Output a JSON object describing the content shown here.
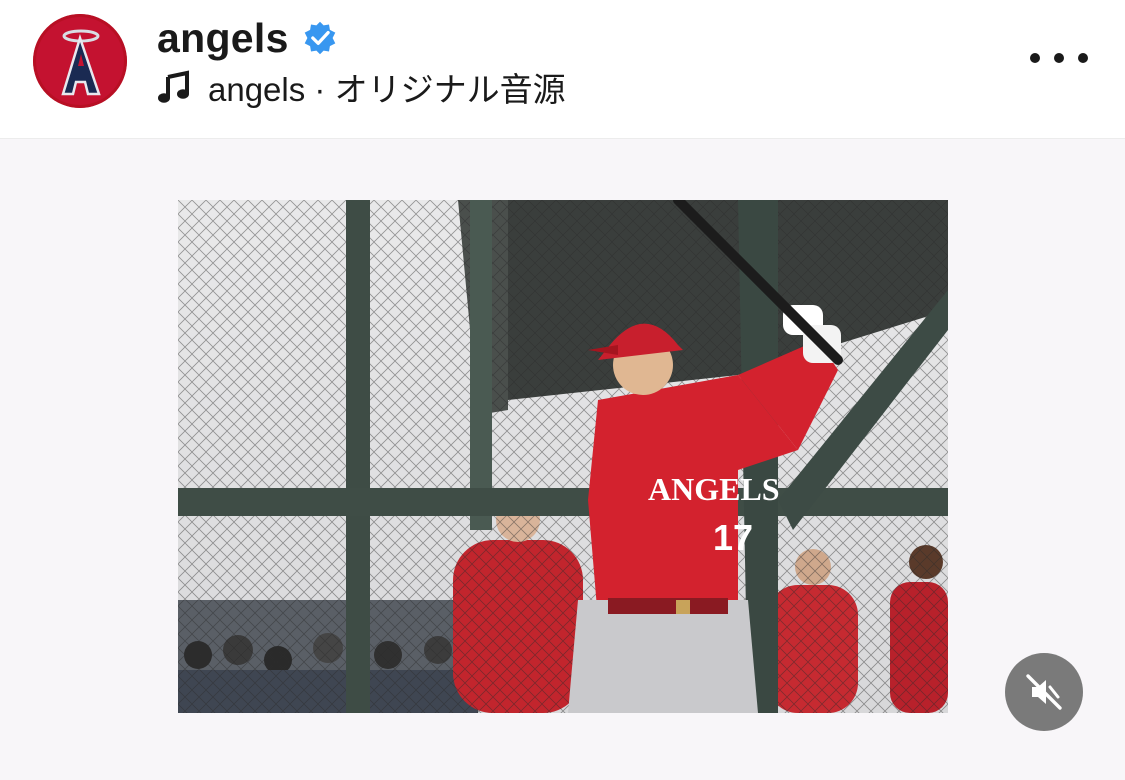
{
  "post": {
    "username": "angels",
    "verified": true,
    "audio_label": "angels · オリジナル音源"
  },
  "icons": {
    "avatar": "angels-logo",
    "verified": "verified-badge-icon",
    "music": "music-note-icon",
    "more": "more-options-icon",
    "mute": "muted-speaker-icon"
  },
  "colors": {
    "accent_blue": "#3897f0",
    "brand_red": "#ba0021",
    "jersey_red": "#d3222e",
    "mute_button": "#7a7a7a"
  },
  "media": {
    "jersey_text": "ANGELS",
    "jersey_number": "17",
    "muted": true
  }
}
